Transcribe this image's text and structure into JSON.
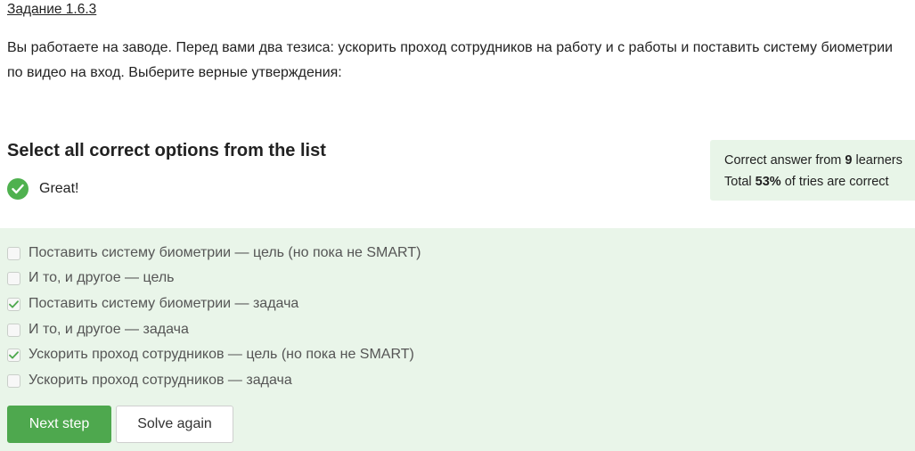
{
  "task": {
    "title": "Задание 1.6.3",
    "text": "Вы работаете на заводе. Перед вами два тезиса: ускорить проход сотрудников на работу и с работы и поставить систему биометрии по видео на вход. Выберите верные утверждения:"
  },
  "question": {
    "title": "Select all correct options from the list",
    "feedback": "Great!"
  },
  "stats": {
    "line1_prefix": "Correct answer from ",
    "learners_count": "9",
    "line1_suffix": " learners",
    "line2_prefix": "Total ",
    "percent": "53%",
    "line2_suffix": " of tries are correct"
  },
  "options": [
    {
      "label": "Поставить систему биометрии — цель (но пока не SMART)",
      "checked": false
    },
    {
      "label": "И то, и другое — цель",
      "checked": false
    },
    {
      "label": "Поставить систему биометрии — задача",
      "checked": true
    },
    {
      "label": "И то, и другое — задача",
      "checked": false
    },
    {
      "label": "Ускорить проход сотрудников — цель (но пока не SMART)",
      "checked": true
    },
    {
      "label": "Ускорить проход сотрудников — задача",
      "checked": false
    }
  ],
  "buttons": {
    "next_step": "Next step",
    "solve_again": "Solve again"
  },
  "colors": {
    "accent_green": "#4ea84e",
    "panel_bg": "#e9f5e9",
    "check_green": "#4fb14f"
  }
}
